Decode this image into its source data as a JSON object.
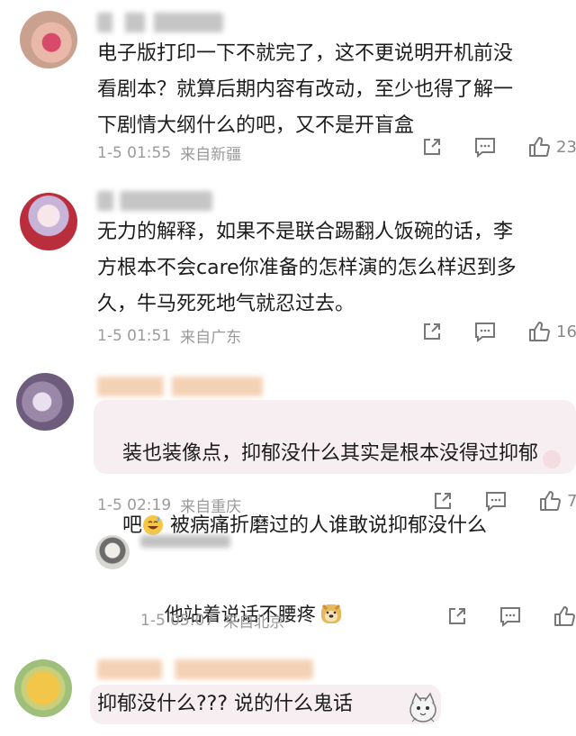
{
  "comments": [
    {
      "text": "电子版打印一下不就完了，这不更说明开机前没\n看剧本？就算后期内容有改动，至少也得了解一\n下剧情大纲什么的吧，又不是开盲盒",
      "date": "1-5 01:55",
      "location": "来自新疆",
      "likes": "23"
    },
    {
      "text": "无力的解释，如果不是联合踢翻人饭碗的话，李\n方根本不会care你准备的怎样演的怎么样迟到多\n久，牛马死死地气就忍过去。",
      "date": "1-5 01:51",
      "location": "来自广东",
      "likes": "16"
    },
    {
      "text_a": "装也装像点，抑郁没什么其实是根本没得过抑郁",
      "text_b": "吧",
      "text_c": " 被病痛折磨过的人谁敢说抑郁没什么",
      "date": "1-5 02:19",
      "location": "来自重庆",
      "likes": "7"
    }
  ],
  "reply": {
    "text": "他站着说话不腰疼",
    "date": "1-5 05:07",
    "location": "来自北京",
    "likes": ""
  },
  "last_comment": {
    "text": "抑郁没什么??? 说的什么鬼话"
  }
}
